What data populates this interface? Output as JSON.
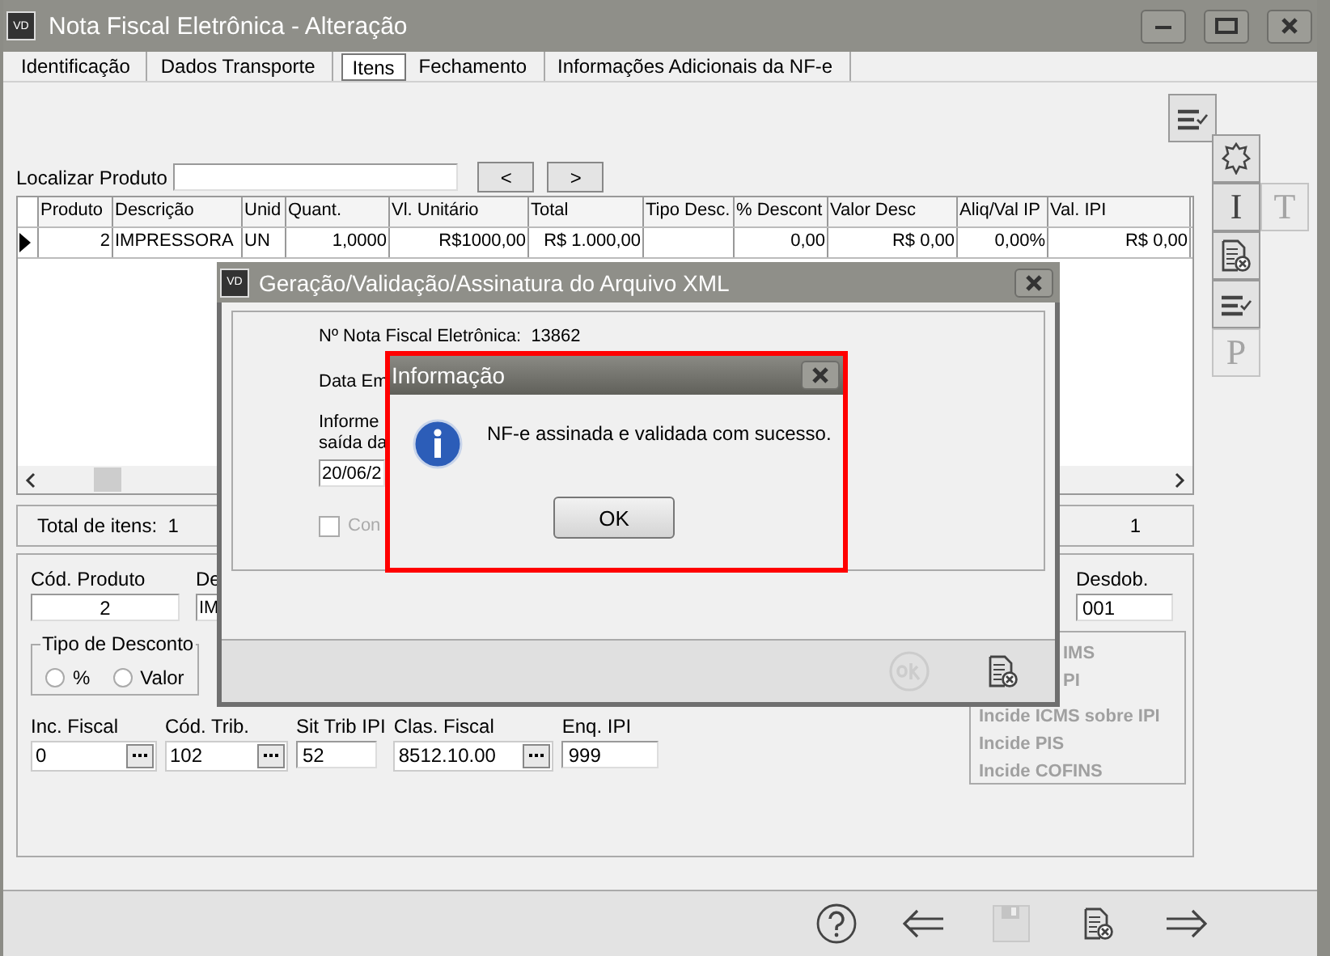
{
  "window": {
    "logo": "VD",
    "title": "Nota Fiscal Eletrônica - Alteração"
  },
  "tabs": [
    {
      "label": "Identificação",
      "selected": false
    },
    {
      "label": "Dados Transporte",
      "selected": false
    },
    {
      "label": "Itens",
      "selected": true
    },
    {
      "label": "Fechamento",
      "selected": false
    },
    {
      "label": "Informações Adicionais da NF-e",
      "selected": false
    }
  ],
  "search": {
    "label": "Localizar Produto",
    "prev": "<",
    "next": ">"
  },
  "grid": {
    "columns": [
      "Produto",
      "Descrição",
      "Unid",
      "Quant.",
      "Vl. Unitário",
      "Total",
      "Tipo Desc.",
      "% Descont",
      "Valor Desc",
      "Aliq/Val IP",
      "Val. IPI"
    ],
    "rows": [
      {
        "selected": true,
        "cells": [
          "2",
          "IMPRESSORA",
          "UN",
          "1,0000",
          "R$1000,00",
          "R$ 1.000,00",
          "",
          "0,00",
          "R$ 0,00",
          "0,00%",
          "R$ 0,00"
        ]
      }
    ]
  },
  "side_tools": [
    {
      "kind": "seal",
      "disabled": false
    },
    {
      "kind": "letter",
      "glyph": "I",
      "disabled": false
    },
    {
      "kind": "letter",
      "glyph": "T",
      "disabled": true
    },
    {
      "kind": "doc-cancel",
      "disabled": false
    },
    {
      "kind": "list-check",
      "disabled": false
    },
    {
      "kind": "letter",
      "glyph": "P",
      "disabled": true
    }
  ],
  "totals": {
    "label": "Total de itens:",
    "count": "1",
    "right_count": "1"
  },
  "details": {
    "cod_label": "Cód. Produto",
    "cod_value": "2",
    "desc_label": "De",
    "desc_value": "IM",
    "desdob_label": "Desdob.",
    "desdob_value": "001",
    "discount": {
      "title": "Tipo de Desconto",
      "options": [
        {
          "label": "%",
          "selected": false
        },
        {
          "label": "Valor",
          "selected": false
        }
      ]
    },
    "fields": [
      {
        "label": "Inc. Fiscal",
        "value": "0",
        "lookup": true
      },
      {
        "label": "Cód. Trib.",
        "value": "102",
        "lookup": true
      },
      {
        "label": "Sit Trib IPI",
        "value": "52",
        "lookup": false
      },
      {
        "label": "Clas. Fiscal",
        "value": "8512.10.00",
        "lookup": true
      },
      {
        "label": "Enq. IPI",
        "value": "999",
        "lookup": false
      }
    ],
    "incide": [
      {
        "label": "IMS",
        "disabled": true
      },
      {
        "label": "PI",
        "disabled": true
      },
      {
        "label": "Incide ICMS sobre IPI",
        "disabled": true
      },
      {
        "label": "Incide PIS",
        "disabled": true
      },
      {
        "label": "Incide COFINS",
        "disabled": true
      }
    ]
  },
  "footer_tools": [
    {
      "kind": "help",
      "disabled": false
    },
    {
      "kind": "back",
      "disabled": false
    },
    {
      "kind": "save",
      "disabled": true
    },
    {
      "kind": "doc-cancel",
      "disabled": false
    },
    {
      "kind": "forward",
      "disabled": false
    }
  ],
  "xml_dialog": {
    "logo": "VD",
    "title": "Geração/Validação/Assinatura do Arquivo XML",
    "nf_label": "Nº Nota Fiscal Eletrônica:",
    "nf_value": "13862",
    "date_label": "Data Em",
    "info_line1": "Informe",
    "info_line2": "saída da",
    "date_value": "20/06/2",
    "checkbox": {
      "label": "Con",
      "checked": false,
      "disabled": true
    },
    "ok_disabled": true
  },
  "info_dialog": {
    "title": "Informação",
    "message": "NF-e assinada e validada com sucesso.",
    "button": "OK"
  }
}
